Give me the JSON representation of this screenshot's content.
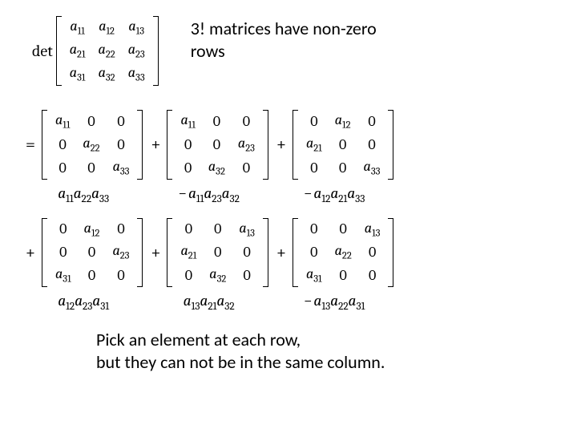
{
  "top_caption_line1": "3! matrices have non-zero",
  "top_caption_line2": "rows",
  "bottom_caption_line1": "Pick an element at each row,",
  "bottom_caption_line2": "but they can not be in the same column.",
  "det_label": "det",
  "lhs_matrix": [
    [
      "a_{11}",
      "a_{12}",
      "a_{13}"
    ],
    [
      "a_{21}",
      "a_{22}",
      "a_{23}"
    ],
    [
      "a_{31}",
      "a_{32}",
      "a_{33}"
    ]
  ],
  "terms": [
    {
      "lead": "=",
      "matrix": [
        [
          "a_{11}",
          "0",
          "0"
        ],
        [
          "0",
          "a_{22}",
          "0"
        ],
        [
          "0",
          "0",
          "a_{33}"
        ]
      ],
      "product_sign": "",
      "product": "a_{11}a_{22}a_{33}"
    },
    {
      "lead": "+",
      "matrix": [
        [
          "a_{11}",
          "0",
          "0"
        ],
        [
          "0",
          "0",
          "a_{23}"
        ],
        [
          "0",
          "a_{32}",
          "0"
        ]
      ],
      "product_sign": "-",
      "product": "a_{11}a_{23}a_{32}"
    },
    {
      "lead": "+",
      "matrix": [
        [
          "0",
          "a_{12}",
          "0"
        ],
        [
          "a_{21}",
          "0",
          "0"
        ],
        [
          "0",
          "0",
          "a_{33}"
        ]
      ],
      "product_sign": "-",
      "product": "a_{12}a_{21}a_{33}"
    },
    {
      "lead": "+",
      "matrix": [
        [
          "0",
          "a_{12}",
          "0"
        ],
        [
          "0",
          "0",
          "a_{23}"
        ],
        [
          "a_{31}",
          "0",
          "0"
        ]
      ],
      "product_sign": "",
      "product": "a_{12}a_{23}a_{31}"
    },
    {
      "lead": "+",
      "matrix": [
        [
          "0",
          "0",
          "a_{13}"
        ],
        [
          "a_{21}",
          "0",
          "0"
        ],
        [
          "0",
          "a_{32}",
          "0"
        ]
      ],
      "product_sign": "",
      "product": "a_{13}a_{21}a_{32}"
    },
    {
      "lead": "+",
      "matrix": [
        [
          "0",
          "0",
          "a_{13}"
        ],
        [
          "0",
          "a_{22}",
          "0"
        ],
        [
          "a_{31}",
          "0",
          "0"
        ]
      ],
      "product_sign": "-",
      "product": "a_{13}a_{22}a_{31}"
    }
  ]
}
